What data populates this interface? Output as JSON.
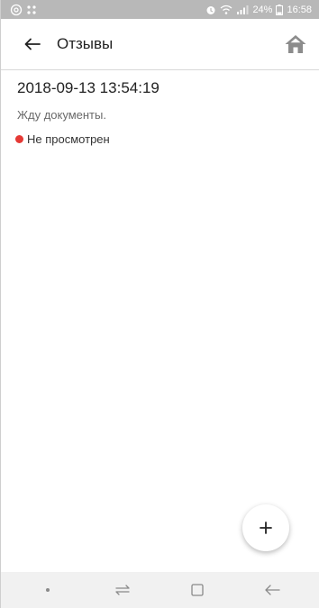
{
  "status_bar": {
    "left_icons": [
      "at-icon",
      "grid-dots-icon"
    ],
    "battery": "24%",
    "time": "16:58"
  },
  "app_bar": {
    "title": "Отзывы"
  },
  "review": {
    "datetime": "2018-09-13 13:54:19",
    "text": "Жду документы.",
    "status": "Не просмотрен",
    "status_color": "#e53935"
  },
  "fab": {
    "label": "+"
  },
  "colors": {
    "status_bar_bg": "#b8b8b8",
    "nav_bar_bg": "#f1f1f1",
    "unread_dot": "#e53935"
  }
}
